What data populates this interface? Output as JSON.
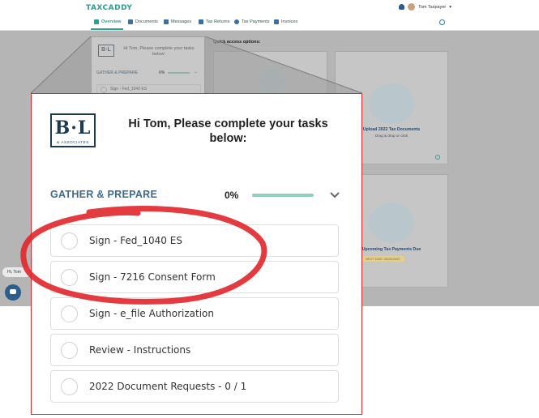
{
  "app": {
    "logo": "TAXCADDY",
    "user_name": "Tom Taxpayer"
  },
  "nav": {
    "items": [
      {
        "label": "Overview",
        "icon": "home-icon",
        "active": true
      },
      {
        "label": "Documents",
        "icon": "documents-icon",
        "active": false
      },
      {
        "label": "Messages",
        "icon": "messages-icon",
        "active": false
      },
      {
        "label": "Tax Returns",
        "icon": "tax-returns-icon",
        "active": false
      },
      {
        "label": "Tax Payments",
        "icon": "tax-payments-icon",
        "active": false
      },
      {
        "label": "Invoices",
        "icon": "invoices-icon",
        "active": false
      }
    ]
  },
  "quick_access": {
    "title": "Quick access options:",
    "cards": [
      {
        "title": "Upload 2022 Tax Documents",
        "subtitle": "Drag & drop or click"
      },
      {
        "title": "Upcoming Tax Payments Due",
        "badge": "NEXT DUE: 06/15/2023"
      }
    ]
  },
  "chat": {
    "label": "Hi, Tom"
  },
  "tasks_panel": {
    "logo_text": "B·L",
    "logo_subtext": "& ASSOCIATES",
    "greeting": "Hi Tom, Please complete your tasks below:",
    "section": {
      "title": "GATHER & PREPARE",
      "percent_label": "0%",
      "progress": 0
    },
    "tasks": [
      {
        "label": "Sign - Fed_1040 ES",
        "completed": false
      },
      {
        "label": "Sign - 7216 Consent Form",
        "completed": false
      },
      {
        "label": "Sign - e_file Authorization",
        "completed": false
      },
      {
        "label": "Review - Instructions",
        "completed": false
      },
      {
        "label": "2022 Document Requests - 0 / 1",
        "completed": false
      }
    ]
  },
  "colors": {
    "accent": "#2f9e8f",
    "section_title": "#3a6a8f",
    "highlight": "#e0262b",
    "progress_track": "#8fcfbd"
  }
}
